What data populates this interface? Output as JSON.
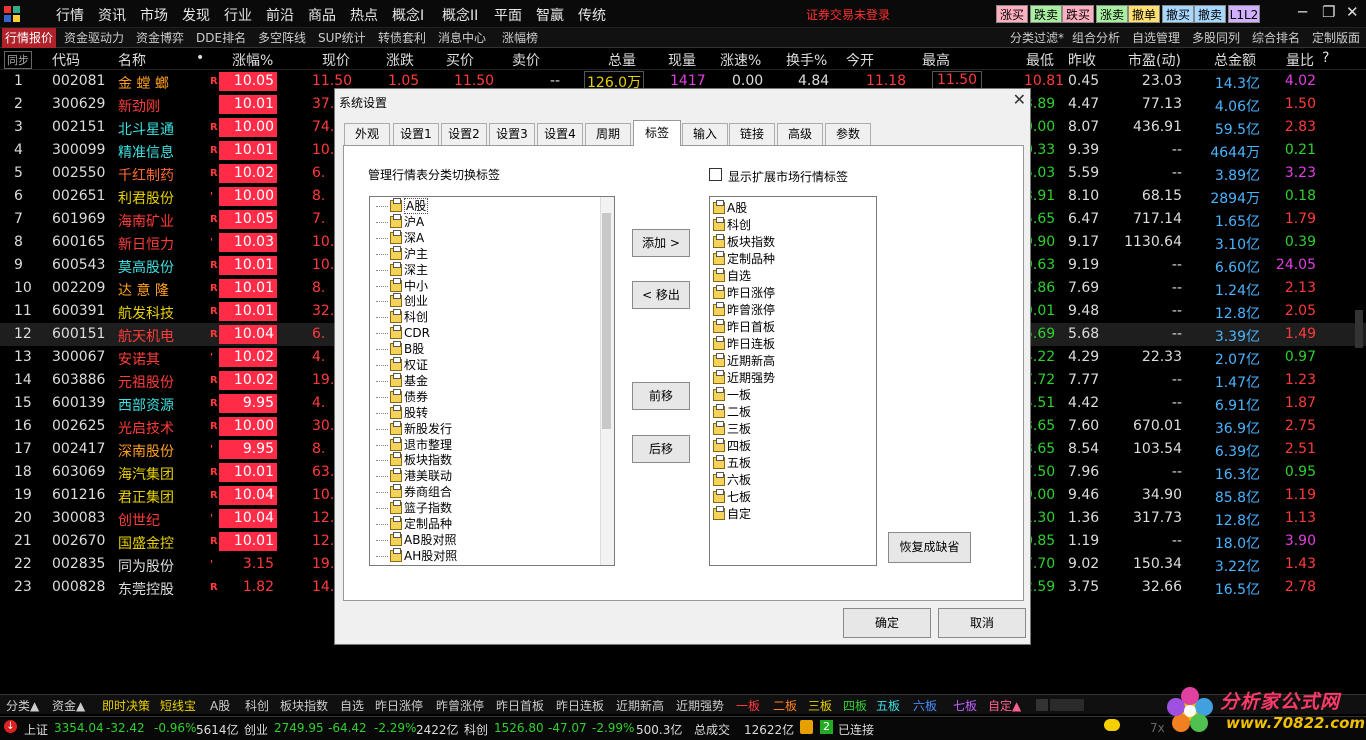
{
  "topmenu": [
    "行情",
    "资讯",
    "市场",
    "发现",
    "行业",
    "前沿",
    "商品",
    "热点",
    "概念I",
    "概念II",
    "平面",
    "智赢",
    "传统"
  ],
  "login_status": "证券交易未登录",
  "trade_buttons": [
    "涨买",
    "跌卖",
    "跌买",
    "涨卖",
    "撤单",
    "撤买",
    "撤卖",
    "L1L2"
  ],
  "trade_colors": [
    "#ffb0c0",
    "#a8f0a0",
    "#ffb0c0",
    "#a8f0a0",
    "#ffe070",
    "#a8d8ff",
    "#a8d8ff",
    "#d0b0ff"
  ],
  "tabs": [
    "行情报价",
    "资金驱动力",
    "资金博弈",
    "DDE排名",
    "多空阵线",
    "SUP统计",
    "转债套利",
    "消息中心",
    "涨幅榜"
  ],
  "tabs_right": [
    "分类过滤*",
    "组合分析",
    "自选管理",
    "多股同列",
    "综合排名",
    "定制版面"
  ],
  "headers": [
    "同步",
    "代码",
    "名称",
    "•",
    "涨幅%",
    "现价",
    "涨跌",
    "买价",
    "卖价",
    "总量",
    "现量",
    "涨速%",
    "换手%",
    "今开",
    "最高",
    "最低",
    "昨收",
    "市盈(动)",
    "总金额",
    "量比",
    "?"
  ],
  "rows": [
    {
      "n": "1",
      "code": "002081",
      "name": "金 螳 螂",
      "mark": "R",
      "pct": "10.05",
      "price": "11.50",
      "chg": "1.05",
      "bid": "11.50",
      "ask": "--",
      "vol": "126.0万",
      "cur": "1417",
      "speed": "0.00",
      "turn": "4.84",
      "open": "11.18",
      "high": "11.50",
      "low": "10.81",
      "prev": "0.45",
      "pe": "23.03",
      "amt": "14.3亿",
      "vr": "4.02"
    },
    {
      "n": "2",
      "code": "300629",
      "name": "新劲刚",
      "mark": "",
      "pct": "10.01",
      "price": "37.",
      "low": "3.89",
      "prev": "4.47",
      "pe": "77.13",
      "amt": "4.06亿",
      "vr": "1.50"
    },
    {
      "n": "3",
      "code": "002151",
      "name": "北斗星通",
      "mark": "R",
      "pct": "10.00",
      "price": "74.",
      "low": "0.00",
      "prev": "8.07",
      "pe": "436.91",
      "amt": "59.5亿",
      "vr": "2.83"
    },
    {
      "n": "4",
      "code": "300099",
      "name": "精准信息",
      "mark": "R",
      "pct": "10.01",
      "price": "10.",
      "low": "0.33",
      "prev": "9.39",
      "pe": "--",
      "amt": "4644万",
      "vr": "0.21"
    },
    {
      "n": "5",
      "code": "002550",
      "name": "千红制药",
      "mark": "R",
      "pct": "10.02",
      "price": "6.",
      "low": "5.03",
      "prev": "5.59",
      "pe": "--",
      "amt": "3.89亿",
      "vr": "3.23"
    },
    {
      "n": "6",
      "code": "002651",
      "name": "利君股份",
      "mark": "'",
      "pct": "10.00",
      "price": "8.",
      "low": "3.91",
      "prev": "8.10",
      "pe": "68.15",
      "amt": "2894万",
      "vr": "0.18"
    },
    {
      "n": "7",
      "code": "601969",
      "name": "海南矿业",
      "mark": "R",
      "pct": "10.05",
      "price": "7.",
      "low": "5.65",
      "prev": "6.47",
      "pe": "717.14",
      "amt": "1.65亿",
      "vr": "1.79"
    },
    {
      "n": "8",
      "code": "600165",
      "name": "新日恒力",
      "mark": "'",
      "pct": "10.03",
      "price": "10.",
      "low": "9.90",
      "prev": "9.17",
      "pe": "1130.64",
      "amt": "3.10亿",
      "vr": "0.39"
    },
    {
      "n": "9",
      "code": "600543",
      "name": "莫高股份",
      "mark": "R",
      "pct": "10.01",
      "price": "10.",
      "low": "9.63",
      "prev": "9.19",
      "pe": "--",
      "amt": "6.60亿",
      "vr": "24.05"
    },
    {
      "n": "10",
      "code": "002209",
      "name": "达 意 隆",
      "mark": "R",
      "pct": "10.01",
      "price": "8.",
      "low": "7.86",
      "prev": "7.69",
      "pe": "--",
      "amt": "1.24亿",
      "vr": "2.13"
    },
    {
      "n": "11",
      "code": "600391",
      "name": "航发科技",
      "mark": "R",
      "pct": "10.01",
      "price": "32.",
      "low": "9.01",
      "prev": "9.48",
      "pe": "--",
      "amt": "12.8亿",
      "vr": "2.05"
    },
    {
      "n": "12",
      "code": "600151",
      "name": "航天机电",
      "mark": "R",
      "pct": "10.04",
      "price": "6.",
      "low": "5.69",
      "prev": "5.68",
      "pe": "--",
      "amt": "3.39亿",
      "vr": "1.49"
    },
    {
      "n": "13",
      "code": "300067",
      "name": "安诺其",
      "mark": "'",
      "pct": "10.02",
      "price": "4.",
      "low": "4.22",
      "prev": "4.29",
      "pe": "22.33",
      "amt": "2.07亿",
      "vr": "0.97"
    },
    {
      "n": "14",
      "code": "603886",
      "name": "元祖股份",
      "mark": "R",
      "pct": "10.02",
      "price": "19.",
      "low": "7.72",
      "prev": "7.77",
      "pe": "--",
      "amt": "1.47亿",
      "vr": "1.23"
    },
    {
      "n": "15",
      "code": "600139",
      "name": "西部资源",
      "mark": "R",
      "pct": "9.95",
      "price": "4.",
      "low": "4.51",
      "prev": "4.42",
      "pe": "--",
      "amt": "6.91亿",
      "vr": "1.87"
    },
    {
      "n": "16",
      "code": "002625",
      "name": "光启技术",
      "mark": "R",
      "pct": "10.00",
      "price": "30.",
      "low": "3.65",
      "prev": "7.60",
      "pe": "670.01",
      "amt": "36.9亿",
      "vr": "2.75"
    },
    {
      "n": "17",
      "code": "002417",
      "name": "深南股份",
      "mark": "'",
      "pct": "9.95",
      "price": "8.",
      "low": "3.65",
      "prev": "8.54",
      "pe": "103.54",
      "amt": "6.39亿",
      "vr": "2.51"
    },
    {
      "n": "18",
      "code": "603069",
      "name": "海汽集团",
      "mark": "R",
      "pct": "10.01",
      "price": "63.",
      "low": "7.50",
      "prev": "7.96",
      "pe": "--",
      "amt": "16.3亿",
      "vr": "0.95"
    },
    {
      "n": "19",
      "code": "601216",
      "name": "君正集团",
      "mark": "R",
      "pct": "10.04",
      "price": "10.",
      "low": "9.00",
      "prev": "9.46",
      "pe": "34.90",
      "amt": "85.8亿",
      "vr": "1.19"
    },
    {
      "n": "20",
      "code": "300083",
      "name": "创世纪",
      "mark": "'",
      "pct": "10.04",
      "price": "12.",
      "low": "1.30",
      "prev": "1.36",
      "pe": "317.73",
      "amt": "12.8亿",
      "vr": "1.13"
    },
    {
      "n": "21",
      "code": "002670",
      "name": "国盛金控",
      "mark": "R",
      "pct": "10.01",
      "price": "12.",
      "low": "0.85",
      "prev": "1.19",
      "pe": "--",
      "amt": "18.0亿",
      "vr": "3.90"
    },
    {
      "n": "22",
      "code": "002835",
      "name": "同为股份",
      "mark": "'",
      "pct": "3.15",
      "price": "19.",
      "low": "7.70",
      "prev": "9.02",
      "pe": "150.34",
      "amt": "3.22亿",
      "vr": "1.43"
    },
    {
      "n": "23",
      "code": "000828",
      "name": "东莞控股",
      "mark": "R",
      "pct": "1.82",
      "price": "14.",
      "low": "2.59",
      "prev": "3.75",
      "pe": "32.66",
      "amt": "16.5亿",
      "vr": "2.78"
    }
  ],
  "bottom_tabs": [
    "分类▲",
    "资金▲",
    "即时决策",
    "短线宝",
    "A股",
    "科创",
    "板块指数",
    "自选",
    "昨日涨停",
    "昨曾涨停",
    "昨日首板",
    "昨日连板",
    "近期新高",
    "近期强势",
    "一板",
    "二板",
    "三板",
    "四板",
    "五板",
    "六板",
    "七板",
    "自定▲"
  ],
  "status": {
    "sh_label": "上证",
    "sh_val": "3354.04",
    "sh_chg": "-32.42",
    "sh_pct": "-0.96%",
    "sh_amt": "5614亿",
    "cy_label": "创业",
    "cy_val": "2749.95",
    "cy_chg": "-64.42",
    "cy_pct": "-2.29%",
    "cy_amt": "2422亿",
    "kc_label": "科创",
    "kc_val": "1526.80",
    "kc_chg": "-47.07",
    "kc_pct": "-2.99%",
    "kc_amt": "500.3亿",
    "total_label": "总成交",
    "total_val": "12622亿",
    "conn_num": "2",
    "conn_text": "已连接",
    "extra": "7x"
  },
  "dialog": {
    "title": "系统设置",
    "tabs": [
      "外观",
      "设置1",
      "设置2",
      "设置3",
      "设置4",
      "周期",
      "标签",
      "输入",
      "链接",
      "高级",
      "参数"
    ],
    "left_label": "管理行情表分类切换标签",
    "checkbox_label": "显示扩展市场行情标签",
    "left_items": [
      "A股",
      "沪A",
      "深A",
      "沪主",
      "深主",
      "中小",
      "创业",
      "科创",
      "CDR",
      "B股",
      "权证",
      "基金",
      "债券",
      "股转",
      "新股发行",
      "退市整理",
      "板块指数",
      "港美联动",
      "券商组合",
      "篮子指数",
      "定制品种",
      "AB股对照",
      "AH股对照"
    ],
    "right_items": [
      "A股",
      "科创",
      "板块指数",
      "定制品种",
      "自选",
      "昨日涨停",
      "昨曾涨停",
      "昨日首板",
      "昨日连板",
      "近期新高",
      "近期强势",
      "一板",
      "二板",
      "三板",
      "四板",
      "五板",
      "六板",
      "七板",
      "自定"
    ],
    "btn_add": "添加 >",
    "btn_remove": "< 移出",
    "btn_up": "前移",
    "btn_down": "后移",
    "btn_restore": "恢复成缺省",
    "btn_ok": "确定",
    "btn_cancel": "取消"
  },
  "watermark": {
    "text": "分析家公式网",
    "url": "www.70822.com"
  }
}
